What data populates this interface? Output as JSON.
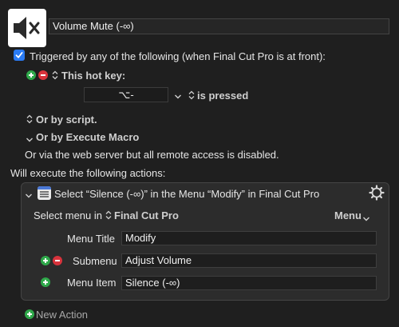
{
  "macro": {
    "name": "Volume Mute (-∞)",
    "icon": "speaker-muted-icon"
  },
  "trigger": {
    "checked": true,
    "header": "Triggered by any of the following (when Final Cut Pro is at front):",
    "hotkey_label": "This hot key:",
    "hotkey_value": "⌥-",
    "pressed_label": "is pressed",
    "or_by_script": "Or by script.",
    "or_by_execute": "Or by Execute Macro",
    "web_server": "Or via the web server but all remote access is disabled."
  },
  "actions": {
    "header": "Will execute the following actions:",
    "action_title": "Select “Silence (-∞)” in the Menu “Modify” in Final Cut Pro",
    "select_menu_in": "Select menu in",
    "app_name": "Final Cut Pro",
    "menu_dropdown": "Menu",
    "menu_title_label": "Menu Title",
    "menu_title_value": "Modify",
    "submenu_label": "Submenu",
    "submenu_value": "Adjust Volume",
    "menu_item_label": "Menu Item",
    "menu_item_value": "Silence (-∞)",
    "new_action": "New Action"
  },
  "colors": {
    "background": "#1f1f1f",
    "accent_blue": "#2a7bf4",
    "plus_green": "#2fa84a",
    "minus_red": "#d8333c"
  }
}
